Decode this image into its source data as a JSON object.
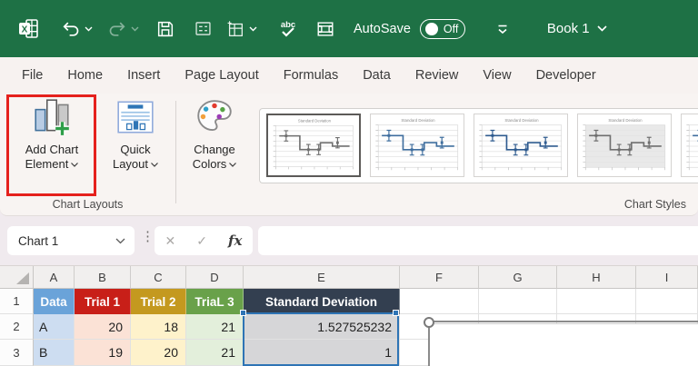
{
  "titlebar": {
    "autosave_label": "AutoSave",
    "autosave_state": "Off",
    "workbook_name": "Book 1"
  },
  "ribbon": {
    "tabs": [
      "File",
      "Home",
      "Insert",
      "Page Layout",
      "Formulas",
      "Data",
      "Review",
      "View",
      "Developer"
    ],
    "add_chart_element": {
      "line1": "Add Chart",
      "line2": "Element"
    },
    "quick_layout": {
      "line1": "Quick",
      "line2": "Layout"
    },
    "change_colors": {
      "line1": "Change",
      "line2": "Colors"
    },
    "group_chart_layouts": "Chart Layouts",
    "group_chart_styles": "Chart Styles",
    "thumb_title": "Standard Deviation"
  },
  "formula_bar": {
    "name_box_value": "Chart 1",
    "cancel_glyph": "✕",
    "enter_glyph": "✓",
    "fx_glyph": "fx",
    "dots_glyph": "⋮",
    "formula_value": ""
  },
  "grid": {
    "columns": [
      "A",
      "B",
      "C",
      "D",
      "E",
      "F",
      "G",
      "H",
      "I"
    ],
    "rows": [
      {
        "num": "1",
        "cells": [
          "Data",
          "Trial 1",
          "Trial 2",
          "TriaL 3",
          "Standard Deviation"
        ]
      },
      {
        "num": "2",
        "cells": [
          "A",
          "20",
          "18",
          "21",
          "1.527525232"
        ]
      },
      {
        "num": "3",
        "cells": [
          "B",
          "19",
          "20",
          "21",
          "1"
        ]
      }
    ]
  },
  "colors": {
    "green": "#1E7145",
    "annotation_red": "#E5211D",
    "hdr_blue": "#6AA3D9",
    "hdr_red": "#C81F18",
    "hdr_gold": "#C4991F",
    "hdr_green": "#69A14A",
    "hdr_navy": "#333F50",
    "fill_blue": "#CDDDF1",
    "fill_red": "#FBE2D6",
    "fill_gold": "#FEF2CB",
    "fill_green": "#E3EFDB",
    "sel_gray": "#D6D6D8",
    "sel_blue": "#2E74B5",
    "icon_blue": "#2E75B6"
  }
}
